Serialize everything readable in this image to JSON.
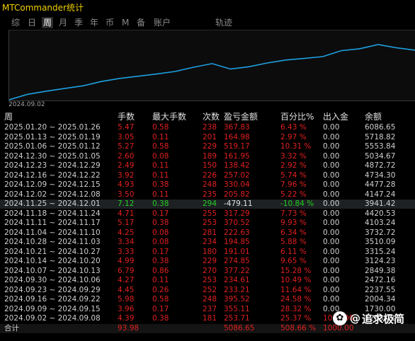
{
  "app": {
    "title": "MTCommander统计"
  },
  "tabs": [
    {
      "label": "综"
    },
    {
      "label": "日"
    },
    {
      "label": "周"
    },
    {
      "label": "月"
    },
    {
      "label": "季"
    },
    {
      "label": "年"
    },
    {
      "label": "币"
    },
    {
      "label": "M"
    },
    {
      "label": "备"
    },
    {
      "label": "账户"
    },
    {
      "label": "轨迹"
    }
  ],
  "active_tab": "周",
  "chart": {
    "start_date_label": "2024.09.02",
    "line_color": "#1e9fe0",
    "series": [
      1253.71,
      1730,
      2004.34,
      2237.55,
      2472.16,
      2849.38,
      3124.23,
      3315.24,
      3510.09,
      3732.72,
      4103.24,
      4420.53,
      3941.42,
      4147.24,
      4477.28,
      4734.3,
      4872.72,
      5034.67,
      5553.84,
      5718.82,
      6086.65,
      5800,
      5600
    ]
  },
  "table": {
    "headers": {
      "period": "周",
      "hands": "手数",
      "max_hands": "最大手数",
      "count": "次数",
      "pnl": "盈亏金额",
      "pct": "百分比%",
      "io": "出入金",
      "balance": "余额"
    },
    "rows": [
      {
        "period": "2025.01.20 ~ 2025.01.26",
        "hands": "5.47",
        "max_hands": "0.58",
        "count": "238",
        "pnl": "367.83",
        "pct": "6.43 %",
        "io": "0.00",
        "balance": "6086.65"
      },
      {
        "period": "2025.01.13 ~ 2025.01.19",
        "hands": "3.05",
        "max_hands": "0.11",
        "count": "201",
        "pnl": "164.98",
        "pct": "2.97 %",
        "io": "0.00",
        "balance": "5718.82"
      },
      {
        "period": "2025.01.06 ~ 2025.01.12",
        "hands": "5.27",
        "max_hands": "0.58",
        "count": "229",
        "pnl": "519.17",
        "pct": "10.31 %",
        "io": "0.00",
        "balance": "5553.84"
      },
      {
        "period": "2024.12.30 ~ 2025.01.05",
        "hands": "2.60",
        "max_hands": "0.08",
        "count": "189",
        "pnl": "161.95",
        "pct": "3.32 %",
        "io": "0.00",
        "balance": "5034.67"
      },
      {
        "period": "2024.12.23 ~ 2024.12.29",
        "hands": "2.49",
        "max_hands": "0.11",
        "count": "150",
        "pnl": "138.42",
        "pct": "2.92 %",
        "io": "0.00",
        "balance": "4872.72"
      },
      {
        "period": "2024.12.16 ~ 2024.12.22",
        "hands": "3.92",
        "max_hands": "0.11",
        "count": "226",
        "pnl": "257.02",
        "pct": "5.74 %",
        "io": "0.00",
        "balance": "4734.30"
      },
      {
        "period": "2024.12.09 ~ 2024.12.15",
        "hands": "4.93",
        "max_hands": "0.38",
        "count": "248",
        "pnl": "330.04",
        "pct": "7.96 %",
        "io": "0.00",
        "balance": "4477.28"
      },
      {
        "period": "2024.12.02 ~ 2024.12.08",
        "hands": "3.50",
        "max_hands": "0.11",
        "count": "235",
        "pnl": "205.82",
        "pct": "5.22 %",
        "io": "0.00",
        "balance": "4147.24"
      },
      {
        "period": "2024.11.25 ~ 2024.12.01",
        "hands": "7.12",
        "max_hands": "0.38",
        "count": "294",
        "pnl": "-479.11",
        "pct": "-10.84 %",
        "io": "0.00",
        "balance": "3941.42",
        "negative": true
      },
      {
        "period": "2024.11.18 ~ 2024.11.24",
        "hands": "4.71",
        "max_hands": "0.17",
        "count": "255",
        "pnl": "317.29",
        "pct": "7.73 %",
        "io": "0.00",
        "balance": "4420.53"
      },
      {
        "period": "2024.11.11 ~ 2024.11.17",
        "hands": "5.17",
        "max_hands": "0.38",
        "count": "253",
        "pnl": "370.52",
        "pct": "9.93 %",
        "io": "0.00",
        "balance": "4103.24"
      },
      {
        "period": "2024.11.04 ~ 2024.11.10",
        "hands": "4.25",
        "max_hands": "0.08",
        "count": "281",
        "pnl": "222.63",
        "pct": "6.34 %",
        "io": "0.00",
        "balance": "3732.72"
      },
      {
        "period": "2024.10.28 ~ 2024.11.03",
        "hands": "3.34",
        "max_hands": "0.08",
        "count": "234",
        "pnl": "194.85",
        "pct": "5.88 %",
        "io": "0.00",
        "balance": "3510.09"
      },
      {
        "period": "2024.10.21 ~ 2024.10.27",
        "hands": "3.33",
        "max_hands": "0.17",
        "count": "180",
        "pnl": "191.01",
        "pct": "6.11 %",
        "io": "0.00",
        "balance": "3315.24"
      },
      {
        "period": "2024.10.14 ~ 2024.10.20",
        "hands": "4.99",
        "max_hands": "0.38",
        "count": "229",
        "pnl": "274.85",
        "pct": "9.65 %",
        "io": "0.00",
        "balance": "3124.23"
      },
      {
        "period": "2024.10.07 ~ 2024.10.13",
        "hands": "6.79",
        "max_hands": "0.86",
        "count": "270",
        "pnl": "377.22",
        "pct": "15.28 %",
        "io": "0.00",
        "balance": "2849.38"
      },
      {
        "period": "2024.09.30 ~ 2024.10.06",
        "hands": "4.27",
        "max_hands": "0.11",
        "count": "253",
        "pnl": "234.61",
        "pct": "10.49 %",
        "io": "0.00",
        "balance": "2472.16"
      },
      {
        "period": "2024.09.23 ~ 2024.09.29",
        "hands": "4.45",
        "max_hands": "0.26",
        "count": "252",
        "pnl": "233.21",
        "pct": "11.64 %",
        "io": "0.00",
        "balance": "2237.55"
      },
      {
        "period": "2024.09.16 ~ 2024.09.22",
        "hands": "5.98",
        "max_hands": "0.58",
        "count": "248",
        "pnl": "395.52",
        "pct": "24.58 %",
        "io": "0.00",
        "balance": "2004.34"
      },
      {
        "period": "2024.09.09 ~ 2024.09.15",
        "hands": "3.96",
        "max_hands": "0.17",
        "count": "237",
        "pnl": "355.11",
        "pct": "28.32 %",
        "io": "0.00",
        "balance": "1730.00"
      },
      {
        "period": "2024.09.02 ~ 2024.09.08",
        "hands": "4.39",
        "max_hands": "0.38",
        "count": "181",
        "pnl": "253.71",
        "pct": "25.37 %",
        "io": "1000.00",
        "balance": "1253.71"
      }
    ],
    "total": {
      "period": "合计",
      "hands": "93.98",
      "max_hands": "",
      "count": "",
      "pnl": "5086.65",
      "pct": "508.66 %",
      "io": "1000.00",
      "balance": ""
    }
  },
  "watermark": {
    "text": "追求极简",
    "at": "@"
  }
}
